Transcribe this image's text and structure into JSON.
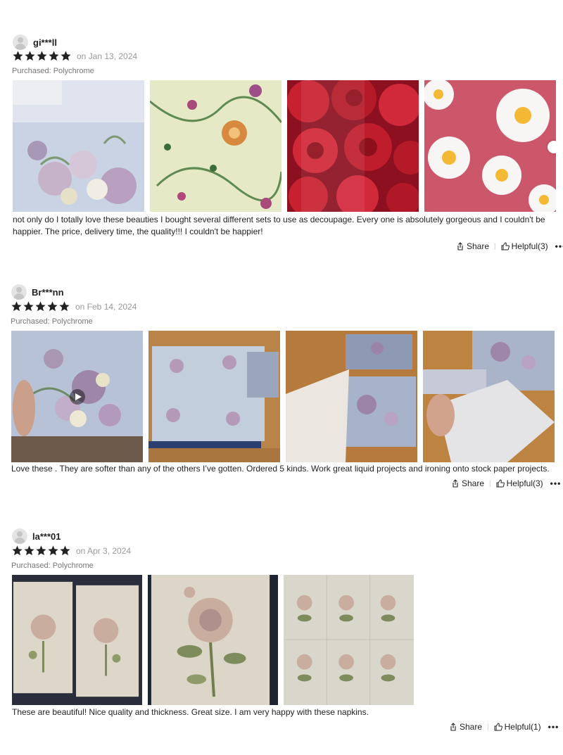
{
  "reviews": [
    {
      "username": "gi***ll",
      "rating": 5,
      "date": "on Jan 13, 2024",
      "purchased": "Purchased: Polychrome",
      "photos": [
        "photo-lilac-roses-napkin",
        "photo-green-floral-napkin",
        "photo-red-roses-napkin",
        "photo-daisy-napkin"
      ],
      "text": "not only do I totally love these beauties I bought several different sets to use as decoupage. Every one is absolutely gorgeous and I couldn't be happier. The price, delivery time, the quality!!! I couldn't be happier!",
      "share": "Share",
      "helpful": "Helpful(3)",
      "more": "•••"
    },
    {
      "username": "Br***nn",
      "rating": 5,
      "date": "on Feb 14, 2024",
      "purchased": "Purchased: Polychrome",
      "photos": [
        "video-lilac-napkin",
        "photo-napkin-on-table",
        "photo-napkin-layers",
        "photo-napkin-peeling"
      ],
      "text": "Love these . They are softer than any of the others I’ve gotten. Ordered 5 kinds. Work great liquid projects and ironing onto stock paper projects.",
      "share": "Share",
      "helpful": "Helpful(3)",
      "more": "•••"
    },
    {
      "username": "la***01",
      "rating": 5,
      "date": "on Apr 3, 2024",
      "purchased": "Purchased: Polychrome",
      "photos": [
        "photo-two-rose-napkins",
        "photo-rose-napkin-closeup",
        "photo-rose-napkin-grid"
      ],
      "text": "These are beautiful! Nice quality and thickness. Great size. I am very happy with these napkins.",
      "share": "Share",
      "helpful": "Helpful(1)",
      "more": "•••"
    }
  ],
  "colors": {
    "star": "#222222",
    "muted": "#999999",
    "text": "#222222"
  }
}
